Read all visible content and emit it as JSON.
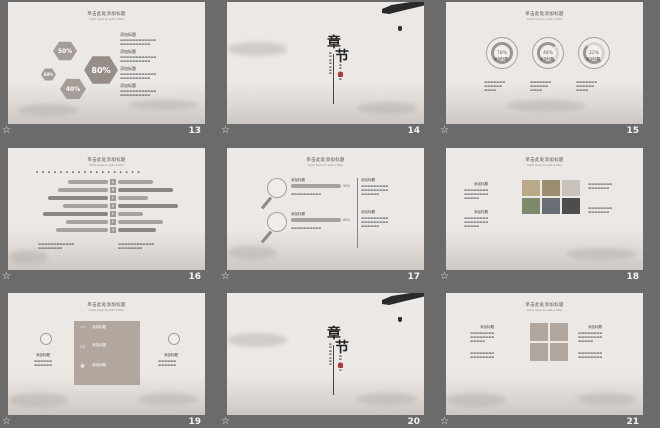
{
  "slides": [
    {
      "number": "13",
      "title": "单击此处添加标题",
      "subtitle": "Click here to add a title",
      "hexes": [
        "50%",
        "80%",
        "60%",
        "40%"
      ],
      "items": [
        "添加标题",
        "添加标题",
        "添加标题",
        "添加标题"
      ]
    },
    {
      "number": "14",
      "chapter": [
        "章",
        "节"
      ]
    },
    {
      "number": "15",
      "title": "单击此处添加标题",
      "subtitle": "Click here to add a title",
      "rings": [
        {
          "value": "78%",
          "label": "添加标题"
        },
        {
          "value": "48%",
          "label": "添加标题"
        },
        {
          "value": "22%",
          "label": "添加标题"
        }
      ]
    },
    {
      "number": "16",
      "title": "单击此处添加标题",
      "subtitle": "Click here to add a title",
      "letters": [
        "A",
        "B",
        "C",
        "D",
        "E",
        "F",
        "G"
      ]
    },
    {
      "number": "17",
      "title": "单击此处添加标题",
      "subtitle": "Click here to add a title",
      "items": [
        "添加标题",
        "添加标题"
      ],
      "percents": [
        "50%",
        "60%"
      ]
    },
    {
      "number": "18",
      "title": "单击此处添加标题",
      "subtitle": "Click here to add a title",
      "items": [
        "添加标题",
        "添加标题"
      ]
    },
    {
      "number": "19",
      "title": "单击此处添加标题",
      "subtitle": "Click here to add a title",
      "items": [
        "添加标题",
        "添加标题",
        "添加标题",
        "添加标题",
        "添加标题"
      ]
    },
    {
      "number": "20",
      "chapter": [
        "章",
        "节"
      ]
    },
    {
      "number": "21",
      "title": "单击此处添加标题",
      "subtitle": "Click here to add a title",
      "items": [
        "添加标题",
        "添加标题"
      ]
    }
  ],
  "star_glyph": "☆",
  "colors": {
    "background": "#6b6b6b",
    "slide": "#ece8e5",
    "accent": "#a39893"
  }
}
